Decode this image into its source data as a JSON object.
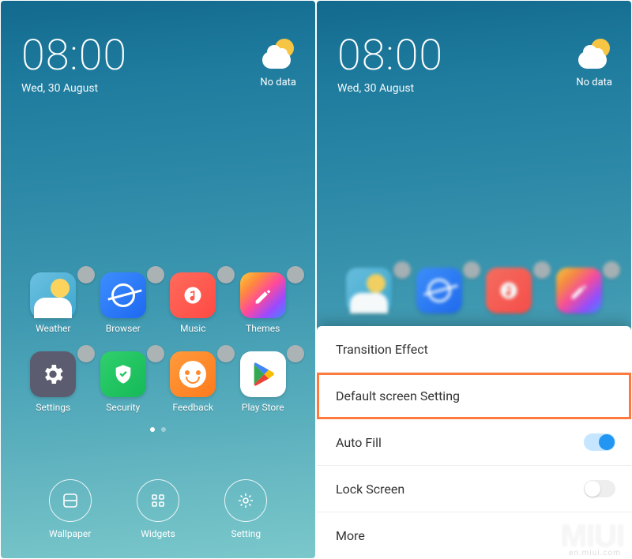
{
  "clock": {
    "time": "08:00",
    "date": "Wed, 30 August"
  },
  "weather": {
    "status": "No data"
  },
  "apps_row1": [
    {
      "name": "weather",
      "label": "Weather"
    },
    {
      "name": "browser",
      "label": "Browser"
    },
    {
      "name": "music",
      "label": "Music"
    },
    {
      "name": "themes",
      "label": "Themes"
    }
  ],
  "apps_row2": [
    {
      "name": "settings",
      "label": "Settings"
    },
    {
      "name": "security",
      "label": "Security"
    },
    {
      "name": "feedback",
      "label": "Feedback"
    },
    {
      "name": "playstore",
      "label": "Play Store"
    }
  ],
  "bottom_actions": [
    {
      "name": "wallpaper",
      "label": "Wallpaper"
    },
    {
      "name": "widgets",
      "label": "Widgets"
    },
    {
      "name": "setting",
      "label": "Setting"
    }
  ],
  "sheet": {
    "rows": [
      {
        "label": "Transition Effect",
        "highlight": false,
        "toggle": null
      },
      {
        "label": "Default screen Setting",
        "highlight": true,
        "toggle": null
      },
      {
        "label": "Auto Fill",
        "highlight": false,
        "toggle": "on"
      },
      {
        "label": "Lock Screen",
        "highlight": false,
        "toggle": "off"
      },
      {
        "label": "More",
        "highlight": false,
        "toggle": null
      }
    ]
  },
  "watermark": {
    "main": "MIUI",
    "sub": "en.miui.com"
  }
}
